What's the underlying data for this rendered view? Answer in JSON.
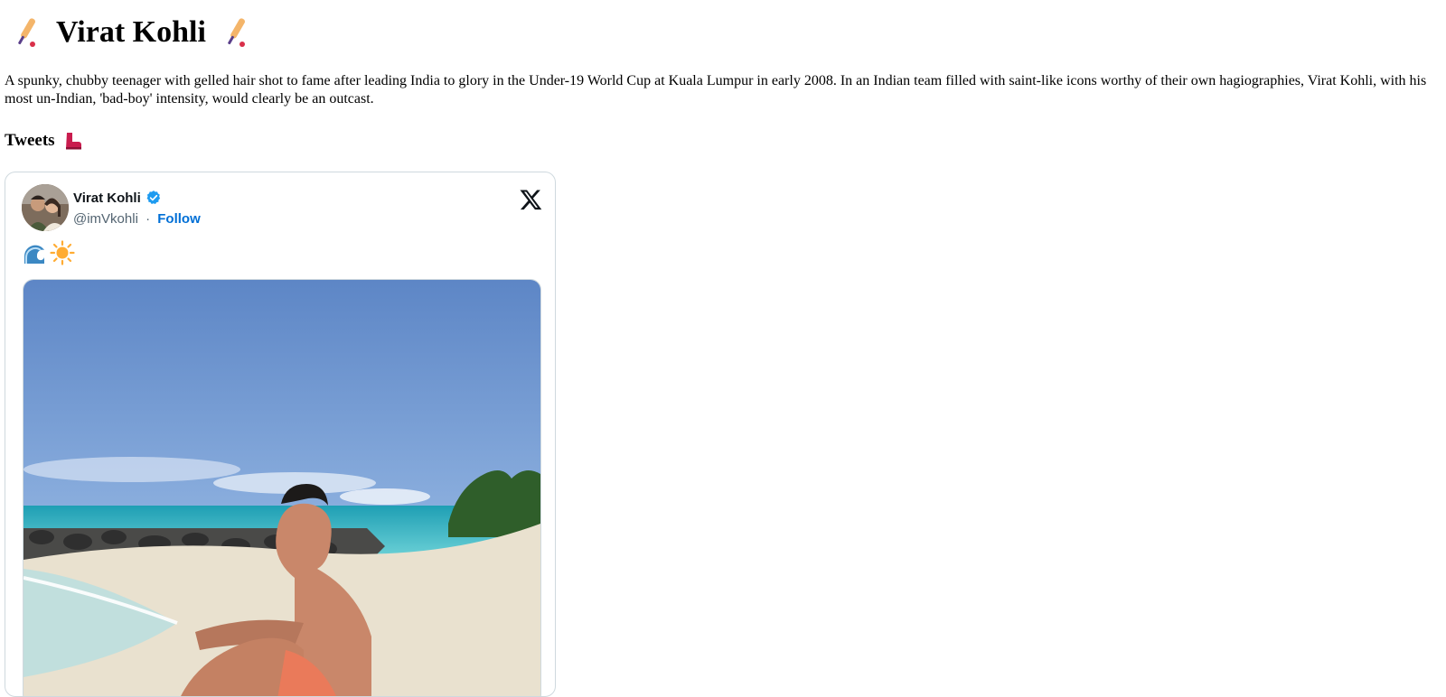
{
  "title": "Virat Kohli",
  "intro": "A spunky, chubby teenager with gelled hair shot to fame after leading India to glory in the Under-19 World Cup at Kuala Lumpur in early 2008. In an Indian team filled with saint-like icons worthy of their own hagiographies, Virat Kohli, with his most un-Indian, 'bad-boy' intensity, would clearly be an outcast.",
  "tweets_heading": "Tweets",
  "tweet": {
    "author_name": "Virat Kohli",
    "handle": "@imVkohli",
    "separator": "·",
    "follow_label": "Follow",
    "text_emojis": [
      "wave-emoji",
      "sun-emoji"
    ]
  },
  "icons": {
    "title_left": "cricket-bat-icon",
    "title_right": "cricket-bat-icon",
    "tweets_heading": "boot-icon",
    "verified": "verified-badge-icon",
    "brand": "x-logo-icon"
  },
  "colors": {
    "link": "#006fd6",
    "verified": "#1d9bf0",
    "border": "#cfd9de",
    "muted": "#536471"
  }
}
